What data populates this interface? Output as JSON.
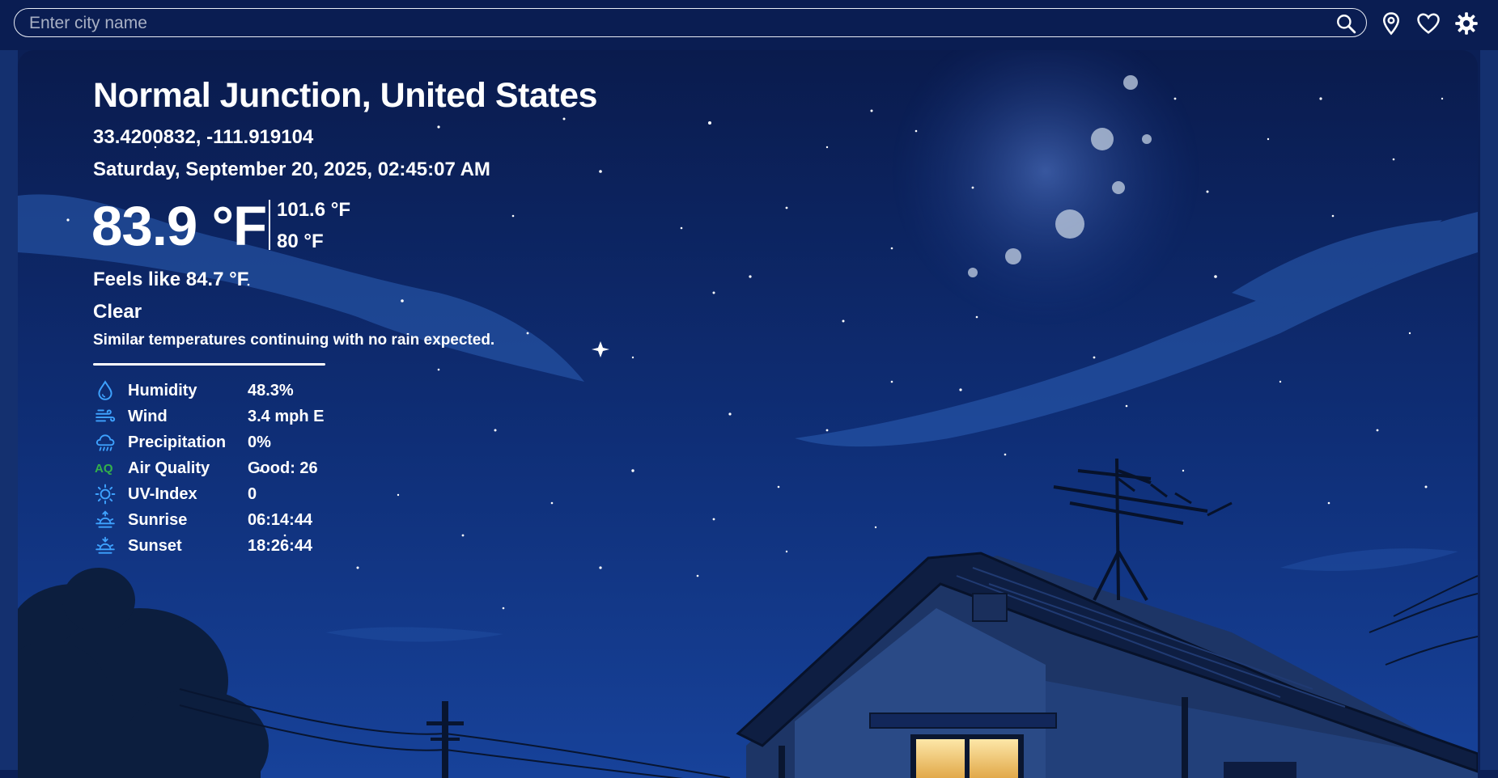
{
  "search": {
    "placeholder": "Enter city name"
  },
  "top_actions": [
    "search-icon",
    "location-pin-icon",
    "heart-icon",
    "gear-icon"
  ],
  "colors": {
    "sky": "#0b1f55",
    "stat_icon_blue": "#3ea2ff",
    "aq_green": "#33b04a",
    "window_light": "#f0c46a"
  },
  "weather": {
    "location": "Normal Junction, United States",
    "coordinates": "33.4200832, -111.919104",
    "datetime": "Saturday, September 20, 2025, 02:45:07 AM",
    "temperature": "83.9 °F",
    "high": "101.6 °F",
    "low": "80 °F",
    "feels_like": "Feels like 84.7 °F",
    "condition": "Clear",
    "summary": "Similar temperatures continuing with no rain expected.",
    "stats": [
      {
        "label": "Humidity",
        "value": "48.3%",
        "icon": "droplet-icon"
      },
      {
        "label": "Wind",
        "value": "3.4 mph E",
        "icon": "wind-icon"
      },
      {
        "label": "Precipitation",
        "value": "0%",
        "icon": "rain-cloud-icon"
      },
      {
        "label": "Air Quality",
        "value": "Good: 26",
        "icon": "air-quality-icon",
        "icon_text": "AQ"
      },
      {
        "label": "UV-Index",
        "value": "0",
        "icon": "sun-icon"
      },
      {
        "label": "Sunrise",
        "value": "06:14:44",
        "icon": "sunrise-icon"
      },
      {
        "label": "Sunset",
        "value": "18:26:44",
        "icon": "sunset-icon"
      }
    ]
  }
}
